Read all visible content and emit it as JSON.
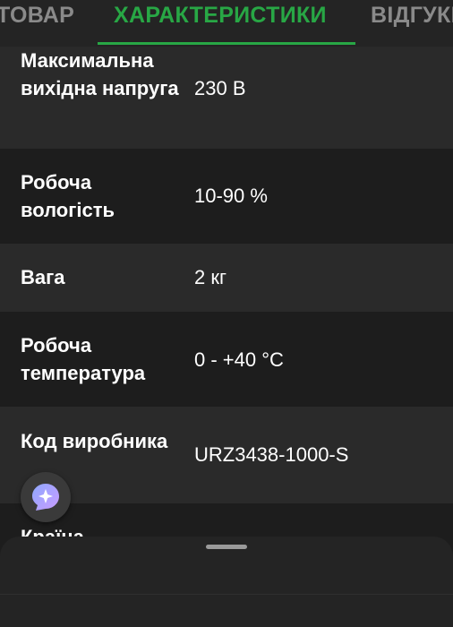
{
  "tabs": {
    "product": "ТОВАР",
    "specs": "ХАРАКТЕРИСТИКИ",
    "reviews": "ВІДГУКИ"
  },
  "specs": [
    {
      "name": "Максимальна вихідна напруга",
      "value": "230 В"
    },
    {
      "name": "Робоча вологість",
      "value": "10-90 %"
    },
    {
      "name": "Вага",
      "value": "2 кг"
    },
    {
      "name": "Робоча температура",
      "value": "0 - +40 °C"
    },
    {
      "name": "Код виробника",
      "value": "URZ3438-1000-S"
    },
    {
      "name": "Країна",
      "value": ""
    }
  ],
  "icons": {
    "assistant": "sparkle-chat-icon"
  },
  "colors": {
    "accent": "#28a745",
    "background": "#1d1d1d",
    "row_alt": "#2a2a2a"
  }
}
